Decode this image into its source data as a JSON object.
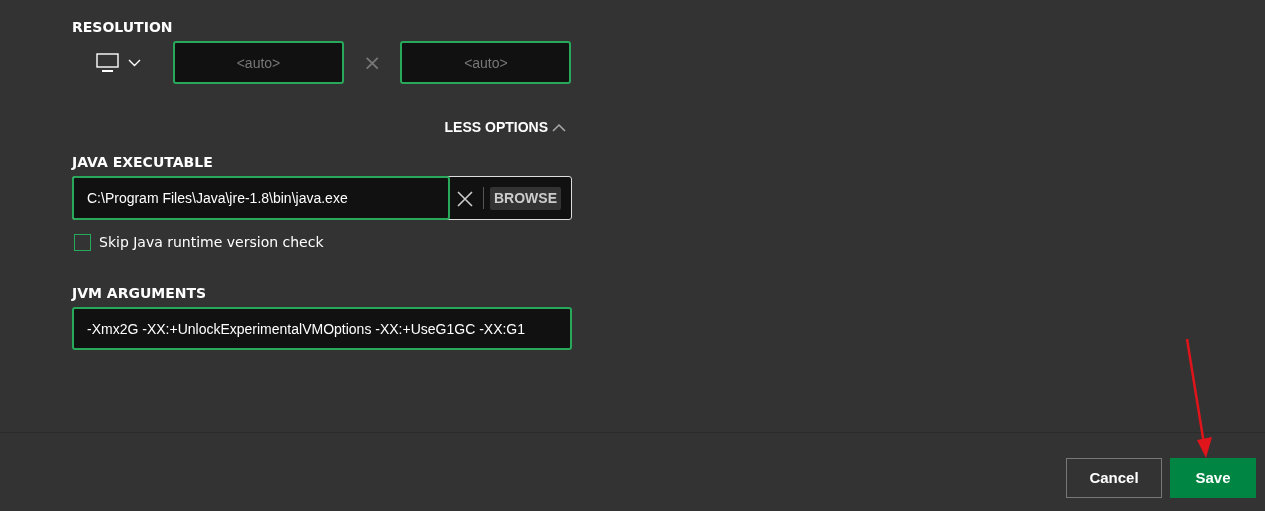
{
  "resolution": {
    "label": "RESOLUTION",
    "width": {
      "placeholder": "<auto>"
    },
    "separator": "×",
    "height": {
      "placeholder": "<auto>"
    }
  },
  "options_toggle": {
    "label": "LESS OPTIONS",
    "expanded": true
  },
  "java_executable": {
    "label": "JAVA EXECUTABLE",
    "value": "C:\\Program Files\\Java\\jre-1.8\\bin\\java.exe",
    "browse": "BROWSE"
  },
  "skip_check": {
    "label": "Skip Java runtime version check",
    "checked": false
  },
  "jvm_arguments": {
    "label": "JVM ARGUMENTS",
    "value": "-Xmx2G -XX:+UnlockExperimentalVMOptions -XX:+UseG1GC -XX:G1"
  },
  "buttons": [
    {
      "label": "Cancel",
      "kind": "secondary"
    },
    {
      "label": "Save",
      "kind": "primary"
    }
  ]
}
